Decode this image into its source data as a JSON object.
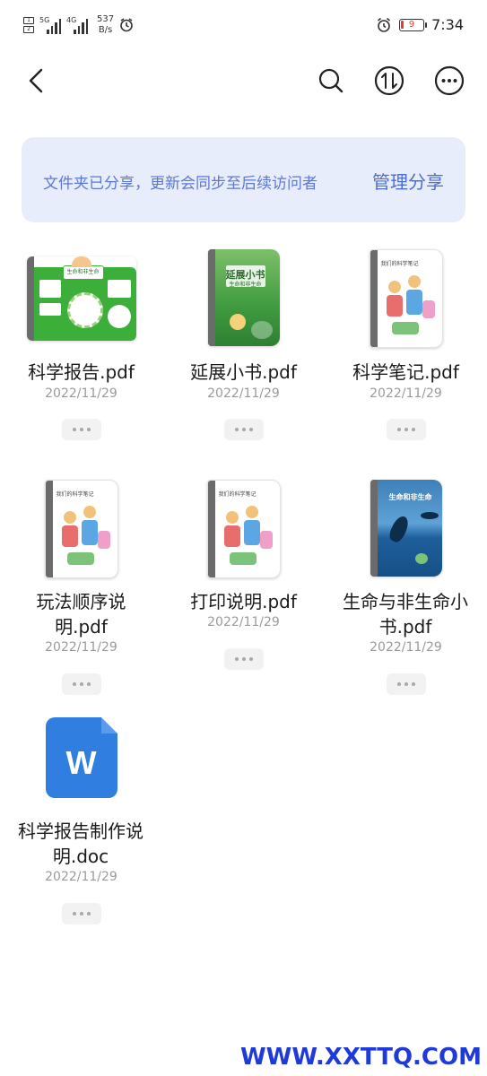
{
  "status_bar": {
    "sim1": "1",
    "sim2": "2",
    "net1": "5G",
    "net2": "4G",
    "speed_value": "537",
    "speed_unit": "B/s",
    "battery": "9",
    "time": "7:34",
    "icons": [
      "alarm-icon",
      "battery-icon"
    ]
  },
  "toolbar": {
    "icons": [
      "back-icon",
      "search-icon",
      "sort-icon",
      "more-icon"
    ]
  },
  "banner": {
    "message": "文件夹已分享，更新会同步至后续访问者",
    "action": "管理分享"
  },
  "files": [
    {
      "name": "科学报告.pdf",
      "date": "2022/11/29",
      "thumb_title": "生命和非生命",
      "thumb_type": "poster"
    },
    {
      "name": "延展小书.pdf",
      "date": "2022/11/29",
      "thumb_title": "延展小书",
      "thumb_subtitle": "生命和非生命",
      "thumb_type": "green-book"
    },
    {
      "name": "科学笔记.pdf",
      "date": "2022/11/29",
      "thumb_title": "我们的科学笔记",
      "thumb_type": "kids-book"
    },
    {
      "name": "玩法顺序说明.pdf",
      "date": "2022/11/29",
      "thumb_title": "我们的科学笔记",
      "thumb_type": "kids-book"
    },
    {
      "name": "打印说明.pdf",
      "date": "2022/11/29",
      "thumb_title": "我们的科学笔记",
      "thumb_type": "kids-book"
    },
    {
      "name": "生命与非生命小书.pdf",
      "date": "2022/11/29",
      "thumb_title": "生命和非生命",
      "thumb_type": "ocean-book"
    },
    {
      "name": "科学报告制作说明.doc",
      "date": "2022/11/29",
      "thumb_letter": "W",
      "thumb_type": "word-doc"
    }
  ],
  "watermark": "WWW.XXTTQ.COM",
  "colors": {
    "banner_bg": "#e8edfb",
    "banner_text": "#5b78d6",
    "word_blue": "#2f7ee0",
    "watermark": "#1f3ad8"
  }
}
